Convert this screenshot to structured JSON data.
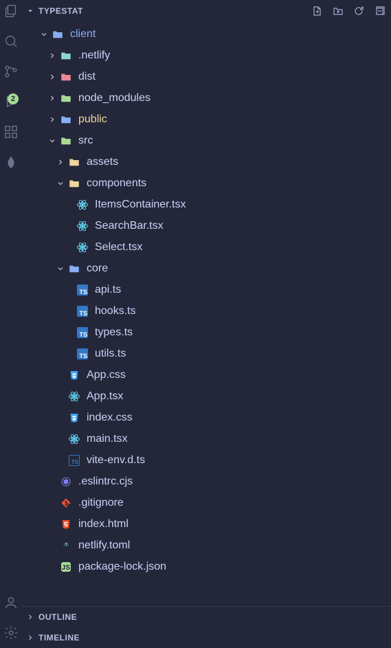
{
  "activityBar": {
    "badge": "2"
  },
  "sections": {
    "explorer": {
      "title": "TYPESTAT"
    },
    "outline": {
      "title": "OUTLINE"
    },
    "timeline": {
      "title": "TIMELINE"
    }
  },
  "tree": [
    {
      "name": "client",
      "type": "folder",
      "color": "blue",
      "depth": 0,
      "expanded": true,
      "cls": "client"
    },
    {
      "name": ".netlify",
      "type": "folder",
      "color": "teal",
      "depth": 1,
      "expanded": false
    },
    {
      "name": "dist",
      "type": "folder",
      "color": "red",
      "depth": 1,
      "expanded": false
    },
    {
      "name": "node_modules",
      "type": "folder",
      "color": "green",
      "depth": 1,
      "expanded": false
    },
    {
      "name": "public",
      "type": "folder",
      "color": "blue",
      "depth": 1,
      "expanded": false,
      "cls": "highlight"
    },
    {
      "name": "src",
      "type": "folder",
      "color": "green",
      "depth": 1,
      "expanded": true
    },
    {
      "name": "assets",
      "type": "folder",
      "color": "yellow",
      "depth": 2,
      "expanded": false
    },
    {
      "name": "components",
      "type": "folder",
      "color": "yellow",
      "depth": 2,
      "expanded": true
    },
    {
      "name": "ItemsContainer.tsx",
      "type": "react",
      "depth": 3
    },
    {
      "name": "SearchBar.tsx",
      "type": "react",
      "depth": 3
    },
    {
      "name": "Select.tsx",
      "type": "react",
      "depth": 3
    },
    {
      "name": "core",
      "type": "folder",
      "color": "blue",
      "depth": 2,
      "expanded": true
    },
    {
      "name": "api.ts",
      "type": "ts",
      "depth": 3
    },
    {
      "name": "hooks.ts",
      "type": "ts",
      "depth": 3
    },
    {
      "name": "types.ts",
      "type": "ts",
      "depth": 3
    },
    {
      "name": "utils.ts",
      "type": "ts",
      "depth": 3
    },
    {
      "name": "App.css",
      "type": "css",
      "depth": 2
    },
    {
      "name": "App.tsx",
      "type": "react",
      "depth": 2
    },
    {
      "name": "index.css",
      "type": "css",
      "depth": 2
    },
    {
      "name": "main.tsx",
      "type": "react",
      "depth": 2
    },
    {
      "name": "vite-env.d.ts",
      "type": "ts-d",
      "depth": 2
    },
    {
      "name": ".eslintrc.cjs",
      "type": "eslint",
      "depth": 1
    },
    {
      "name": ".gitignore",
      "type": "git",
      "depth": 1
    },
    {
      "name": "index.html",
      "type": "html",
      "depth": 1
    },
    {
      "name": "netlify.toml",
      "type": "toml",
      "depth": 1
    },
    {
      "name": "package-lock.json",
      "type": "js",
      "depth": 1
    }
  ]
}
